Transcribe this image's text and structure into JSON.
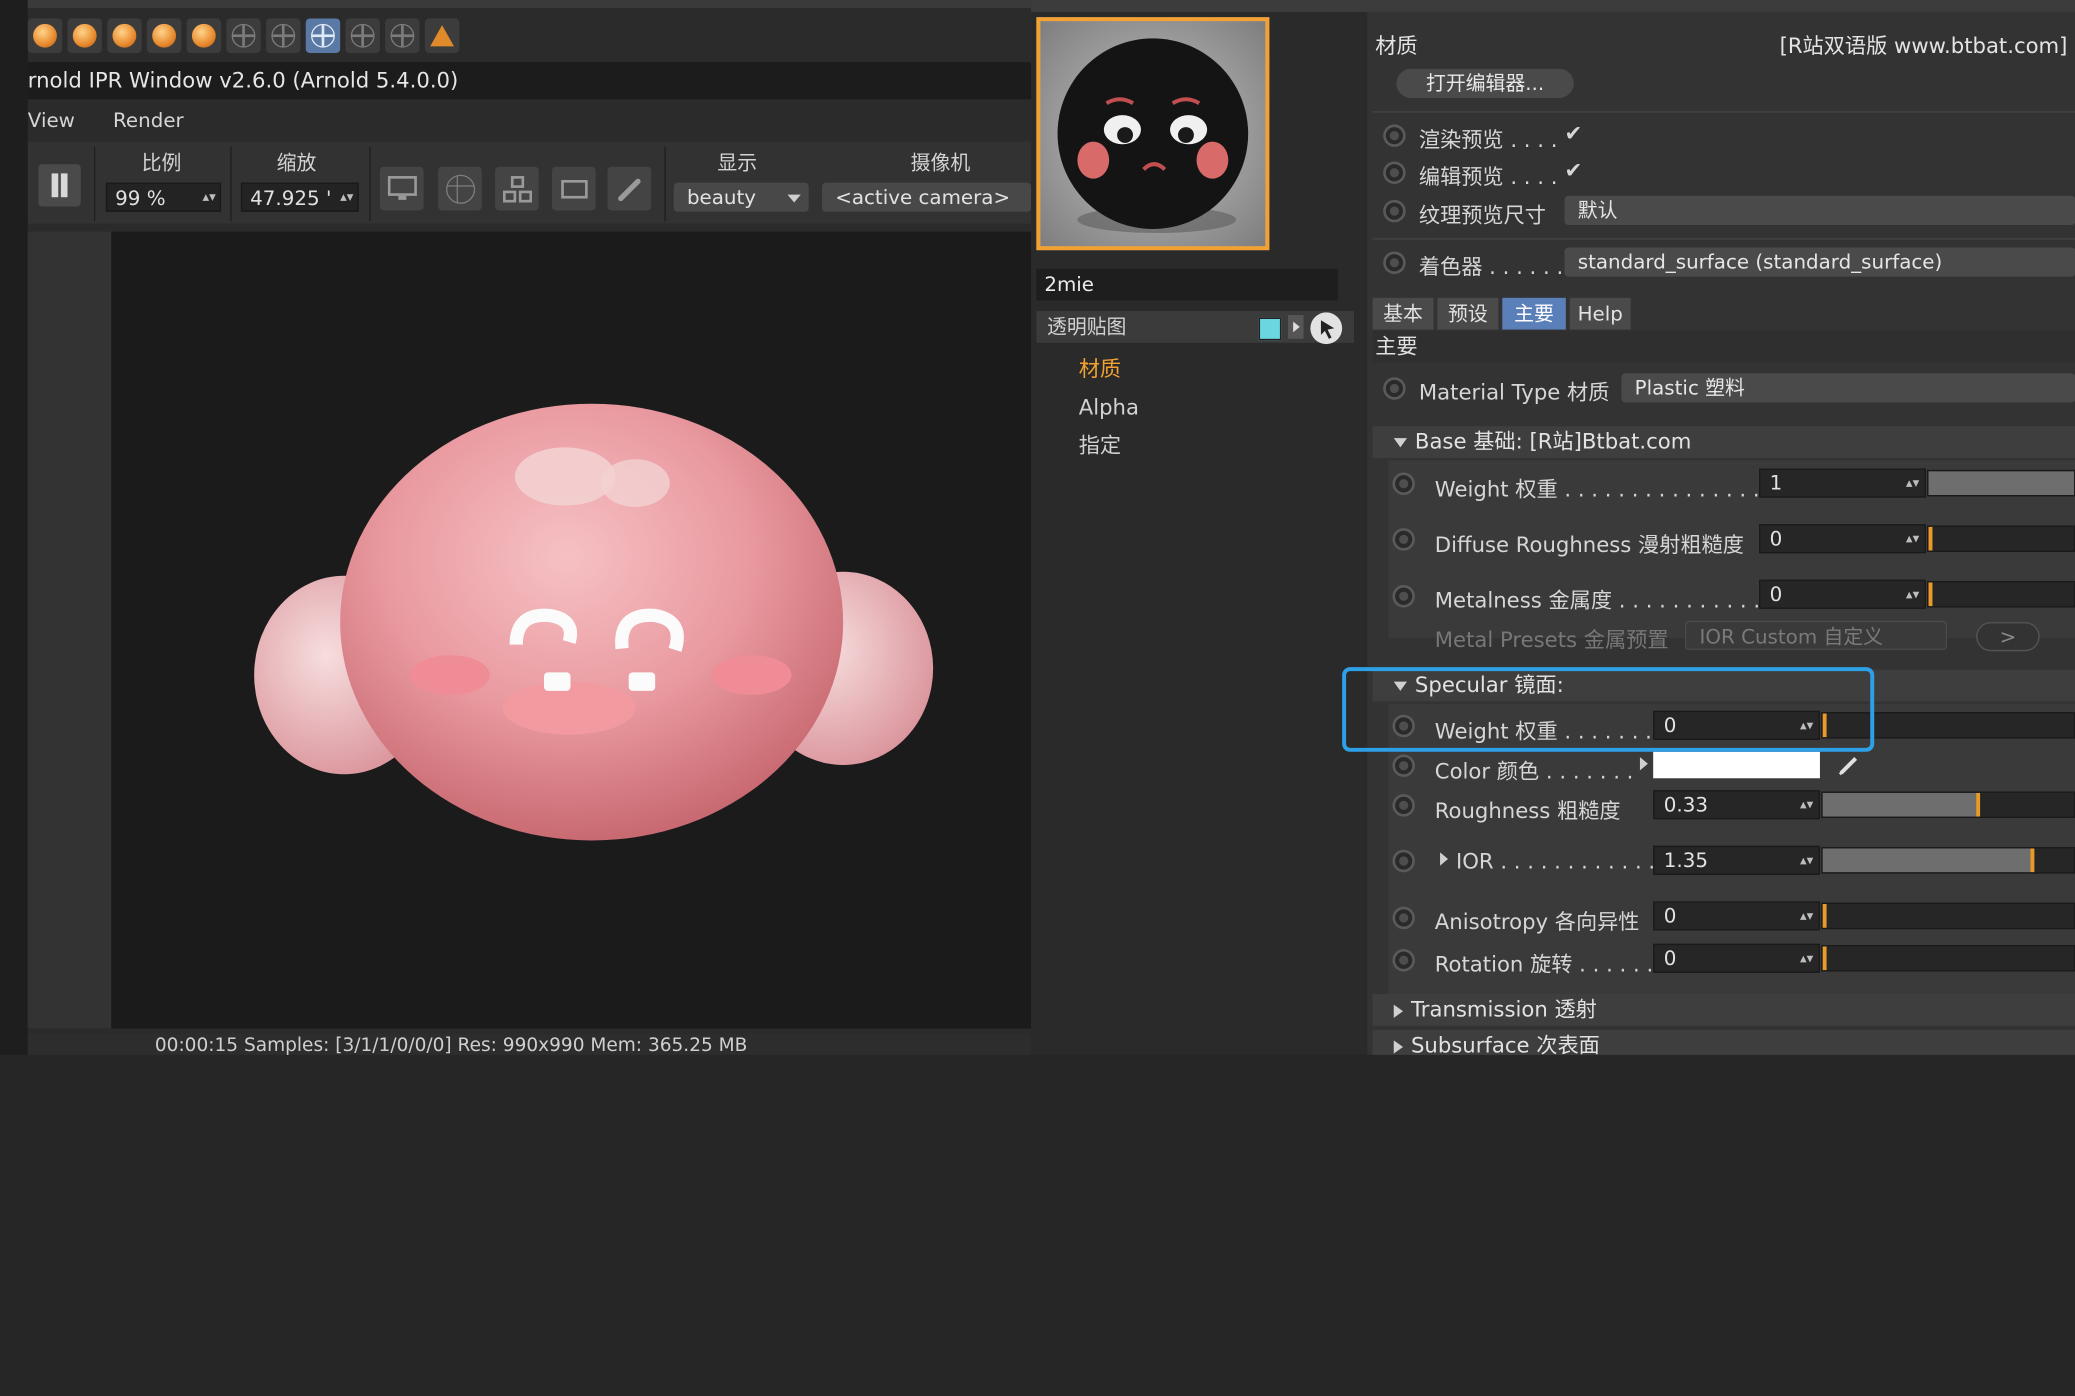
{
  "ipr": {
    "title": "rnold IPR Window v2.6.0 (Arnold 5.4.0.0)",
    "menu": [
      "View",
      "Render"
    ],
    "labels": {
      "scale": "比例",
      "zoom": "缩放",
      "display": "显示",
      "camera": "摄像机"
    },
    "scale_value": "99 %",
    "zoom_value": "47.925 '",
    "display_value": "beauty",
    "camera_value": "<active camera>",
    "status": "00:00:15  Samples: [3/1/1/0/0/0]  Res: 990x990  Mem: 365.25 MB"
  },
  "material": {
    "name": "2mie",
    "channel_row": "透明贴图",
    "channels": [
      "材质",
      "Alpha",
      "指定"
    ],
    "selected_channel": "材质"
  },
  "attributes": {
    "header": "材质",
    "watermark": "[R站双语版 www.btbat.com]",
    "open_editor": "打开编辑器...",
    "render_preview": "渲染预览 . . . .",
    "edit_preview": "编辑预览 . . . .",
    "check": "✔",
    "texture_preview_size": "纹理预览尺寸",
    "texture_preview_value": "默认",
    "shader_label": "着色器 . . . . . .",
    "shader_value": "standard_surface (standard_surface)",
    "tabs": [
      "基本",
      "预设",
      "主要",
      "Help"
    ],
    "active_tab": "主要",
    "main_section": "主要",
    "material_type_label": "Material Type 材质",
    "material_type_value": "Plastic 塑料",
    "base_section": "Base 基础: [R站]Btbat.com",
    "base": {
      "weight_label": "Weight 权重 . . . . . . . . . . . . . . . .",
      "weight_value": "1",
      "diffuse_roughness_label": "Diffuse Roughness 漫射粗糙度",
      "diffuse_roughness_value": "0",
      "metalness_label": "Metalness 金属度 . . . . . . . . . . .",
      "metalness_value": "0",
      "metal_presets_label": "Metal Presets 金属预置",
      "metal_presets_value": "IOR Custom 自定义",
      "metal_presets_btn": ">"
    },
    "specular_section": "Specular 镜面:",
    "specular": {
      "weight_label": "Weight 权重 . . . . . . .",
      "weight_value": "0",
      "color_label": "Color 颜色 . . . . . . .",
      "roughness_label": "Roughness 粗糙度",
      "roughness_value": "0.33",
      "roughness_fraction": 0.33,
      "ior_label": "IOR . . . . . . . . . . . .",
      "ior_value": "1.35",
      "anisotropy_label": "Anisotropy 各向异性",
      "anisotropy_value": "0",
      "rotation_label": "Rotation 旋转 . . . . . .",
      "rotation_value": "0"
    },
    "transmission_section": "Transmission 透射",
    "subsurface_section": "Subsurface 次表面"
  },
  "colors": {
    "accent": "#f2a132",
    "highlight": "#2ea0e8",
    "active_tab": "#5b7fb8",
    "swatch": "#6bd6e0"
  }
}
